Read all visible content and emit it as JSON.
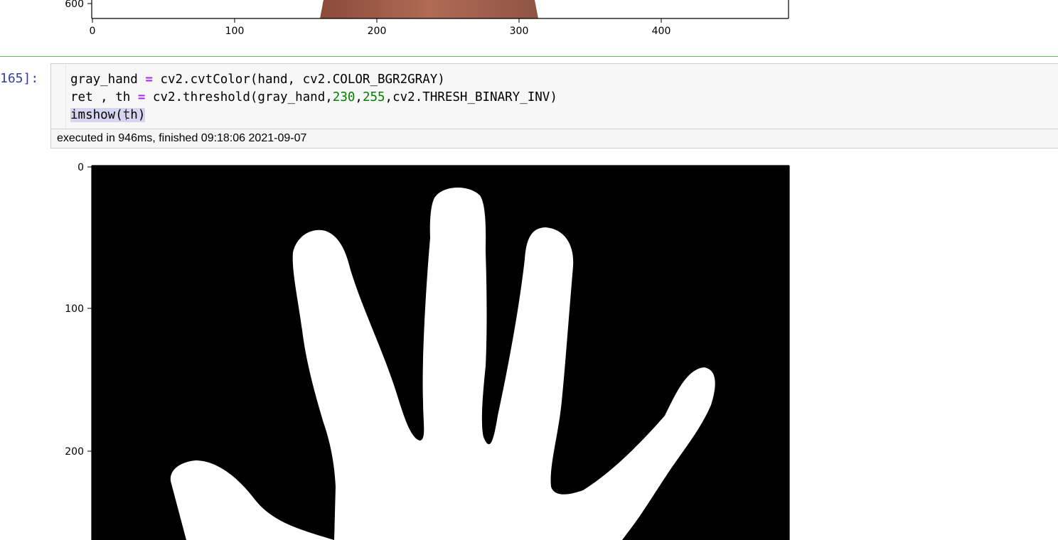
{
  "prev_output": {
    "y_tick_label": "600",
    "x_tick_labels": [
      "0",
      "100",
      "200",
      "300",
      "400"
    ]
  },
  "cell": {
    "prompt": "165]:",
    "code": {
      "line1": {
        "a": "gray_hand ",
        "op": "=",
        "b": " cv2.cvtColor(hand, cv2.COLOR_BGR2GRAY)"
      },
      "line2": {
        "a": "ret , th ",
        "op": "=",
        "b": " cv2.threshold(gray_hand,",
        "n1": "230",
        "c": ",",
        "n2": "255",
        "d": ",cv2.THRESH_BINARY_INV)"
      },
      "line3": "imshow(th)"
    },
    "execution_status": "executed in 946ms, finished 09:18:06 2021-09-07"
  },
  "output_plot": {
    "y_tick_labels": [
      "0",
      "100",
      "200"
    ],
    "image_description_colors": {
      "background": "#000000",
      "foreground": "#ffffff"
    }
  },
  "colors": {
    "operator": "#aa22ff",
    "number": "#008000",
    "prompt": "#303f9f",
    "separator": "#66bb6a"
  }
}
